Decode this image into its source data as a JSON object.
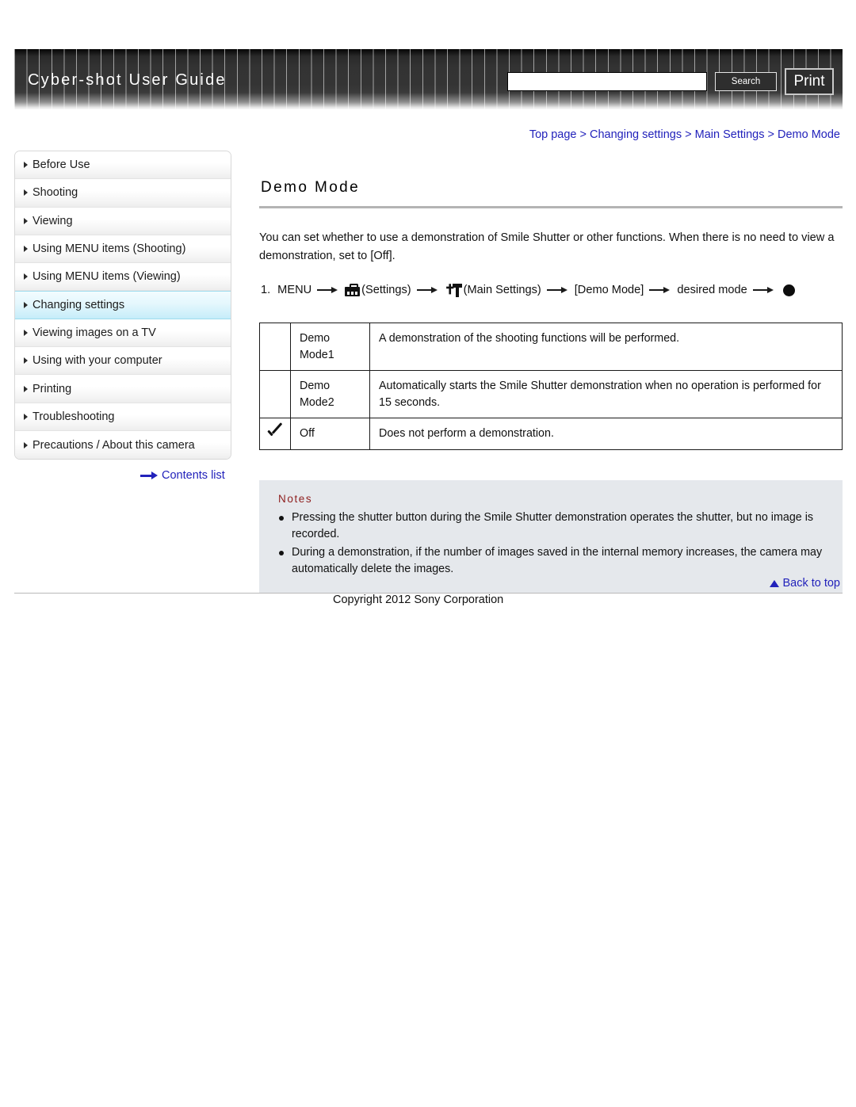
{
  "header": {
    "title": "Cyber-shot User Guide",
    "search_value": "",
    "search_placeholder": "",
    "search_button": "Search",
    "print_button": "Print"
  },
  "sidebar": {
    "items": [
      {
        "label": "Before Use",
        "active": false
      },
      {
        "label": "Shooting",
        "active": false
      },
      {
        "label": "Viewing",
        "active": false
      },
      {
        "label": "Using MENU items (Shooting)",
        "active": false
      },
      {
        "label": "Using MENU items (Viewing)",
        "active": false
      },
      {
        "label": "Changing settings",
        "active": true
      },
      {
        "label": "Viewing images on a TV",
        "active": false
      },
      {
        "label": "Using with your computer",
        "active": false
      },
      {
        "label": "Printing",
        "active": false
      },
      {
        "label": "Troubleshooting",
        "active": false
      },
      {
        "label": "Precautions / About this camera",
        "active": false
      }
    ],
    "contents_link": "Contents list"
  },
  "breadcrumb": {
    "items": [
      "Top page",
      "Changing settings",
      "Main Settings",
      "Demo Mode"
    ],
    "separator": ">"
  },
  "main": {
    "title": "Demo Mode",
    "intro": "You can set whether to use a demonstration of Smile Shutter or other functions. When there is no need to view a demonstration, set to [Off].",
    "step": {
      "number": "1.",
      "menu": "MENU",
      "settings_label": "(Settings)",
      "main_settings_label": "(Main Settings)",
      "demo_mode_label": "[Demo Mode]",
      "desired_mode_label": "desired mode"
    },
    "table": {
      "rows": [
        {
          "checked": false,
          "mode": "Demo\nMode1",
          "description": "A demonstration of the shooting functions will be performed."
        },
        {
          "checked": false,
          "mode": "Demo\nMode2",
          "description": "Automatically starts the Smile Shutter demonstration when no operation is performed for 15 seconds."
        },
        {
          "checked": true,
          "mode": "Off",
          "description": "Does not perform a demonstration."
        }
      ]
    },
    "notes": {
      "title": "Notes",
      "items": [
        "Pressing the shutter button during the Smile Shutter demonstration operates the shutter, but no image is recorded.",
        "During a demonstration, if the number of images saved in the internal memory increases, the camera may automatically delete the images."
      ]
    }
  },
  "footer": {
    "back_to_top": "Back to top",
    "copyright": "Copyright 2012 Sony Corporation"
  },
  "colors": {
    "link": "#2222bb",
    "notes_title": "#8f2020",
    "notes_bg": "#e5e8ec",
    "active_sidebar": "#cdeffa"
  }
}
